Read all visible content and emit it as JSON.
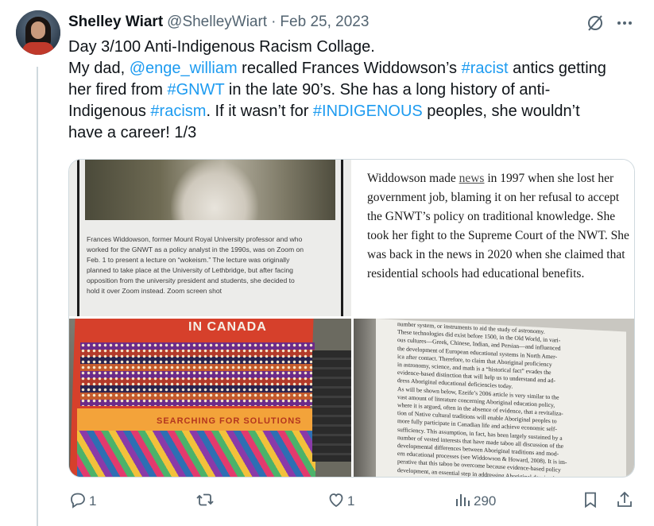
{
  "tweet": {
    "author_name": "Shelley Wiart",
    "author_handle": "@ShelleyWiart",
    "separator": "·",
    "date": "Feb 25, 2023",
    "text_lines": [
      [
        {
          "t": "Day 3/100 Anti-Indigenous Racism Collage.",
          "link": false
        }
      ],
      [
        {
          "t": "My dad, ",
          "link": false
        },
        {
          "t": "@enge_william",
          "link": true
        },
        {
          "t": " recalled Frances Widdowson’s ",
          "link": false
        },
        {
          "t": "#racist",
          "link": true
        },
        {
          "t": " antics getting",
          "link": false
        }
      ],
      [
        {
          "t": "her fired from ",
          "link": false
        },
        {
          "t": "#GNWT",
          "link": true
        },
        {
          "t": " in the late 90’s. She has a long history of anti-",
          "link": false
        }
      ],
      [
        {
          "t": "Indigenous ",
          "link": false
        },
        {
          "t": "#racism",
          "link": true
        },
        {
          "t": ". If it wasn’t for ",
          "link": false
        },
        {
          "t": "#INDIGENOUS",
          "link": true
        },
        {
          "t": " peoples, she wouldn’t",
          "link": false
        }
      ],
      [
        {
          "t": "have a career! 1/3",
          "link": false
        }
      ]
    ],
    "link_color": "#1d9bf0"
  },
  "media": {
    "image1_caption_lines": [
      "Frances Widdowson, former Mount Royal University professor and who",
      "worked for the GNWT as a policy analyst in the 1990s, was on Zoom on",
      "Feb. 1 to present a lecture on “wokeism.” The lecture was originally",
      "planned to take place at the University of Lethbridge, but after facing",
      "opposition from the university president and students, she decided to",
      "hold it over Zoom instead. Zoom screen shot"
    ],
    "image2_article": {
      "before": "Widdowson made ",
      "underlined": "news",
      "after": " in 1997 when she lost her government job, blaming it on her refusal to accept the GNWT’s policy on traditional knowledge. She took her fight to the Supreme Court of the NWT. She was back in the news in 2020 when she claimed that residential schools had educational benefits."
    },
    "image3_book": {
      "title": "IN CANADA",
      "subtitle": "SEARCHING FOR SOLUTIONS"
    },
    "image4_page_lines": [
      "number system, or instruments to aid the study of astronomy.",
      "These technologies did exist before 1500, in the Old World, in vari-",
      "ous cultures—Greek, Chinese, Indian, and Persian—and influenced",
      "the development of European educational systems in North Amer-",
      "ica after contact. Therefore, to claim that Aboriginal proficiency",
      "in astronomy, science, and math is a “historical fact” evades the",
      "evidence-based distinction that will help us to understand and ad-",
      "dress Aboriginal educational deficiencies today.",
      "As will be shown below, Ezeife’s 2006 article is very similar to the",
      "vast amount of literature concerning Aboriginal education policy,",
      "where it is argued, often in the absence of evidence, that a revitaliza-",
      "tion of Native cultural traditions will enable Aboriginal peoples to",
      "more fully participate in Canadian life and achieve economic self-",
      "sufficiency. This assumption, in fact, has been largely sustained by a",
      "number of vested interests that have made taboo all discussion of the",
      "developmental differences between Aboriginal traditions and mod-",
      "ern educational processes (see Widdowson & Howard, 2008). It is im-",
      "perative that this taboo be overcome because evidence-based policy",
      "development, an essential step in addressing Aboriginal deprivation,"
    ]
  },
  "actions": {
    "reply_count": "1",
    "repost_count": "",
    "like_count": "1",
    "views_count": "290"
  },
  "icons": {
    "grok": "grok-icon",
    "more": "more-icon",
    "reply": "reply-icon",
    "repost": "repost-icon",
    "like": "heart-icon",
    "views": "views-icon",
    "bookmark": "bookmark-icon",
    "share": "share-icon"
  },
  "colors": {
    "text": "#0f1419",
    "secondary": "#536471",
    "link": "#1d9bf0",
    "border": "#cfd9de"
  }
}
